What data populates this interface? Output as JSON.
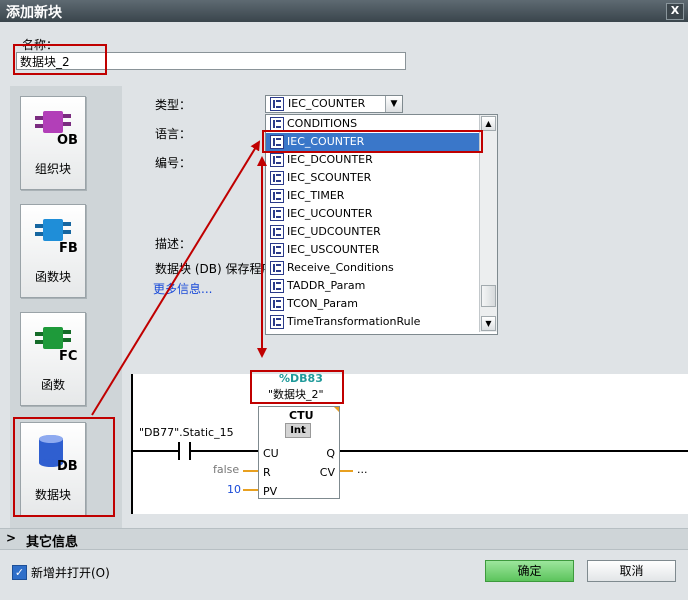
{
  "window": {
    "title": "添加新块",
    "close_glyph": "X"
  },
  "name_field": {
    "label": "名称：",
    "value": "数据块_2"
  },
  "block_types": [
    {
      "label": "组织块",
      "badge": "OB",
      "color": "#b23fb8"
    },
    {
      "label": "函数块",
      "badge": "FB",
      "color": "#1f8ed8"
    },
    {
      "label": "函数",
      "badge": "FC",
      "color": "#1e9a3a"
    },
    {
      "label": "数据块",
      "badge": "DB",
      "color": "#2f5fd0"
    }
  ],
  "properties": {
    "type_label": "类型：",
    "language_label": "语言：",
    "number_label": "编号：",
    "desc_label": "描述：",
    "desc_text": "数据块 (DB) 保存程序",
    "more_info": "更多信息..."
  },
  "type_combo": {
    "value": "IEC_COUNTER"
  },
  "type_dropdown": {
    "options": [
      "CONDITIONS",
      "IEC_COUNTER",
      "IEC_DCOUNTER",
      "IEC_SCOUNTER",
      "IEC_TIMER",
      "IEC_UCOUNTER",
      "IEC_UDCOUNTER",
      "IEC_USCOUNTER",
      "Receive_Conditions",
      "TADDR_Param",
      "TCON_Param",
      "TimeTransformationRule"
    ],
    "selected": "IEC_COUNTER"
  },
  "ladder": {
    "db_address": "%DB83",
    "db_name": "\"数据块_2\"",
    "contact_tag": "\"DB77\".Static_15",
    "block_name": "CTU",
    "block_datatype": "Int",
    "pins": {
      "cu": "CU",
      "r": "R",
      "pv": "PV",
      "q": "Q",
      "cv": "CV"
    },
    "r_value": "false",
    "pv_value": "10",
    "cv_value": "..."
  },
  "additional_info": {
    "label": "其它信息"
  },
  "footer": {
    "add_open_label": "新增并打开(O)",
    "add_open_checked": true,
    "ok_label": "确定",
    "cancel_label": "取消"
  },
  "colors": {
    "highlight_red": "#c00000",
    "selection_blue": "#3a77c9",
    "ok_green": "#5cc45c"
  }
}
